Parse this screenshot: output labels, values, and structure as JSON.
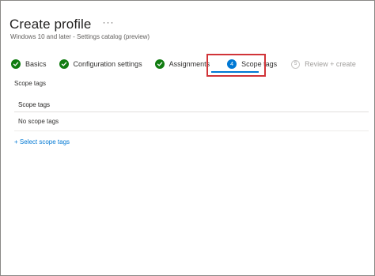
{
  "header": {
    "title": "Create profile",
    "more_label": "···",
    "subtitle": "Windows 10 and later - Settings catalog (preview)"
  },
  "wizard": {
    "steps": [
      {
        "label": "Basics",
        "state": "complete",
        "icon": "checkmark-icon"
      },
      {
        "label": "Configuration settings",
        "state": "complete",
        "icon": "checkmark-icon"
      },
      {
        "label": "Assignments",
        "state": "complete",
        "icon": "checkmark-icon"
      },
      {
        "label": "Scope tags",
        "state": "active",
        "number": "4"
      },
      {
        "label": "Review + create",
        "state": "disabled",
        "number": "5"
      }
    ]
  },
  "content": {
    "section_heading": "Scope tags",
    "table": {
      "header": "Scope tags",
      "empty_text": "No scope tags"
    },
    "select_link": "+ Select scope tags"
  },
  "colors": {
    "complete": "#107c10",
    "active": "#0078d4",
    "highlight_box": "#d13438",
    "link": "#0078d4"
  }
}
